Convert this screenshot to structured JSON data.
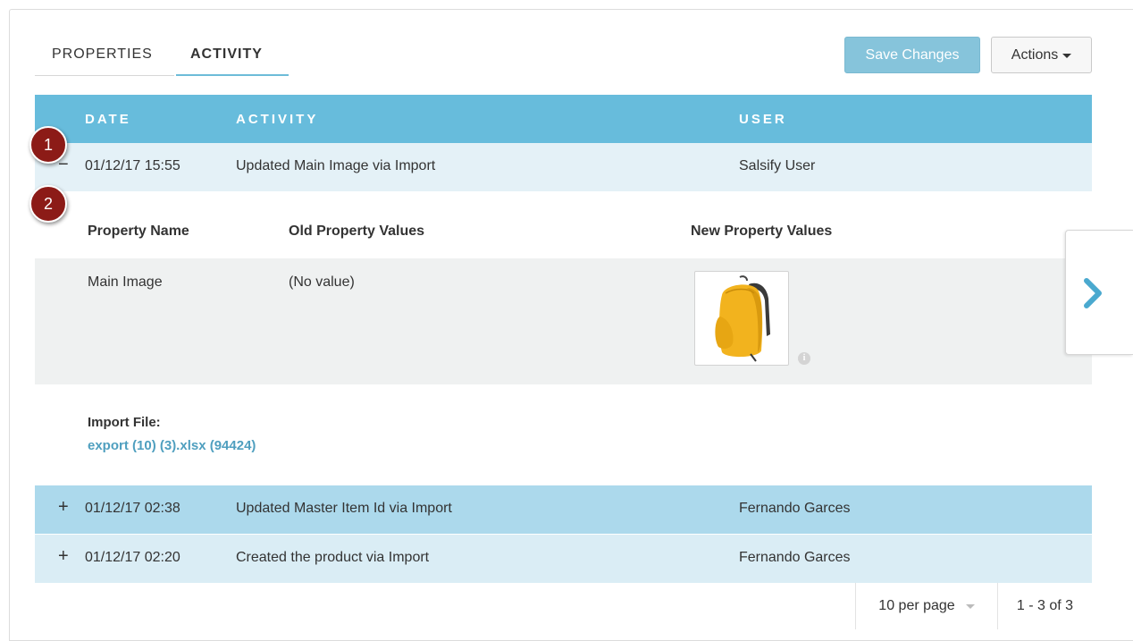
{
  "tabs": [
    {
      "label": "PROPERTIES",
      "active": false
    },
    {
      "label": "ACTIVITY",
      "active": true
    }
  ],
  "toolbar": {
    "save_label": "Save Changes",
    "actions_label": "Actions"
  },
  "table": {
    "columns": [
      "DATE",
      "ACTIVITY",
      "USER"
    ],
    "rows": [
      {
        "toggle": "−",
        "date": "01/12/17 15:55",
        "activity": "Updated Main Image via Import",
        "user": "Salsify User",
        "expanded": true
      },
      {
        "toggle": "+",
        "date": "01/12/17 02:38",
        "activity": "Updated Master Item Id via Import",
        "user": "Fernando Garces",
        "expanded": false
      },
      {
        "toggle": "+",
        "date": "01/12/17 02:20",
        "activity": "Created the product via Import",
        "user": "Fernando Garces",
        "expanded": false
      }
    ]
  },
  "detail": {
    "columns": [
      "Property Name",
      "Old Property Values",
      "New Property Values"
    ],
    "row": {
      "property": "Main Image",
      "old_value": "(No value)",
      "new_value_icon": "backpack-image"
    },
    "import_label": "Import File:",
    "import_link": "export (10) (3).xlsx (94424)"
  },
  "pagination": {
    "per_page": "10 per page",
    "range": "1 - 3 of 3"
  },
  "callouts": [
    "1",
    "2"
  ],
  "colors": {
    "header": "#67bcdc",
    "accent": "#4f9fbf",
    "badge": "#8c1b17",
    "save_button": "#86c4db"
  }
}
